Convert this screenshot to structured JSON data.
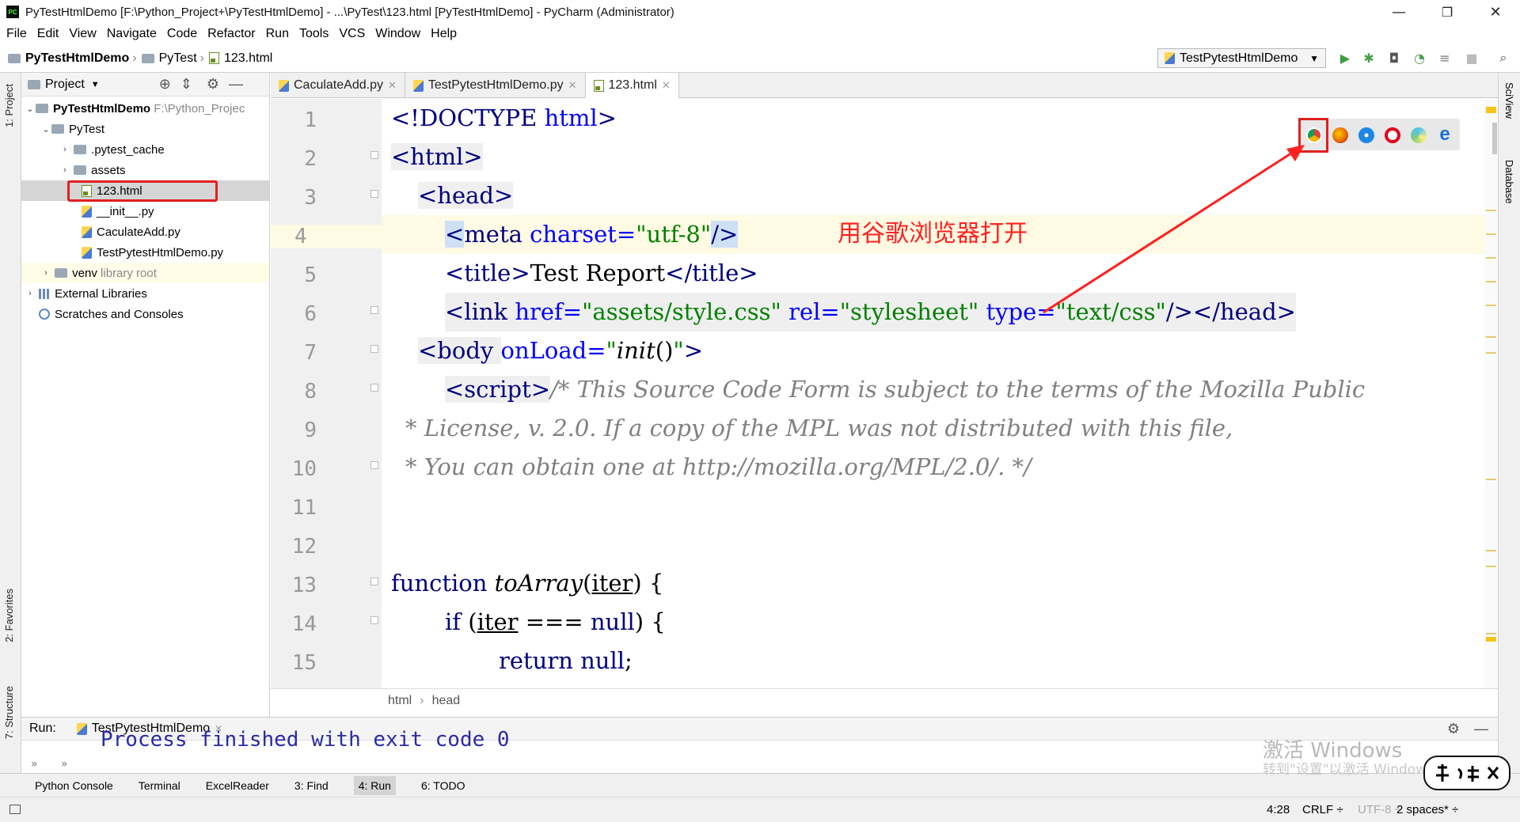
{
  "window": {
    "title": "PyTestHtmlDemo [F:\\Python_Project+\\PyTestHtmlDemo] - ...\\PyTest\\123.html [PyTestHtmlDemo] - PyCharm (Administrator)",
    "minimize": "—",
    "maximize": "❐",
    "close": "✕"
  },
  "menu": [
    "File",
    "Edit",
    "View",
    "Navigate",
    "Code",
    "Refactor",
    "Run",
    "Tools",
    "VCS",
    "Window",
    "Help"
  ],
  "nav": {
    "project": "PyTestHtmlDemo",
    "folder": "PyTest",
    "file": "123.html",
    "run_config": "TestPytestHtmlDemo"
  },
  "project_panel": {
    "title": "Project",
    "tree": [
      {
        "label": "PyTestHtmlDemo",
        "hint": "F:\\Python_Projec"
      },
      {
        "label": "PyTest"
      },
      {
        "label": ".pytest_cache"
      },
      {
        "label": "assets"
      },
      {
        "label": "123.html"
      },
      {
        "label": "__init__.py"
      },
      {
        "label": "CaculateAdd.py"
      },
      {
        "label": "TestPytestHtmlDemo.py"
      },
      {
        "label": "venv",
        "hint": "library root"
      },
      {
        "label": "External Libraries"
      },
      {
        "label": "Scratches and Consoles"
      }
    ]
  },
  "side_tabs": {
    "project": "1: Project",
    "favorites": "2: Favorites",
    "structure": "7: Structure",
    "sciview": "SciView",
    "database": "Database"
  },
  "editor": {
    "tabs": [
      "CaculateAdd.py",
      "TestPytestHtmlDemo.py",
      "123.html"
    ],
    "line_numbers": [
      "1",
      "2",
      "3",
      "4",
      "5",
      "6",
      "7",
      "8",
      "9",
      "10",
      "11",
      "12",
      "13",
      "14",
      "15"
    ],
    "breadcrumb": [
      "html",
      "head"
    ],
    "annotation": "用谷歌浏览器打开"
  },
  "run": {
    "label": "Run:",
    "tab": "TestPytestHtmlDemo",
    "output": "Process finished with exit code 0"
  },
  "toolwindows": [
    "Python Console",
    "Terminal",
    "ExcelReader",
    "3: Find",
    "4: Run",
    "6: TODO"
  ],
  "status": {
    "position": "4:28",
    "line_sep": "CRLF ÷",
    "encoding": "UTF-8 ÷",
    "indent": "2 spaces* ÷"
  },
  "watermark": {
    "line1": "激活 Windows",
    "line2": "转到\"设置\"以激活 Windows。"
  },
  "colors": {
    "annotation_red": "#ff2020",
    "tag_blue": "#000080",
    "string_green": "#008000",
    "comment_gray": "#808080"
  }
}
